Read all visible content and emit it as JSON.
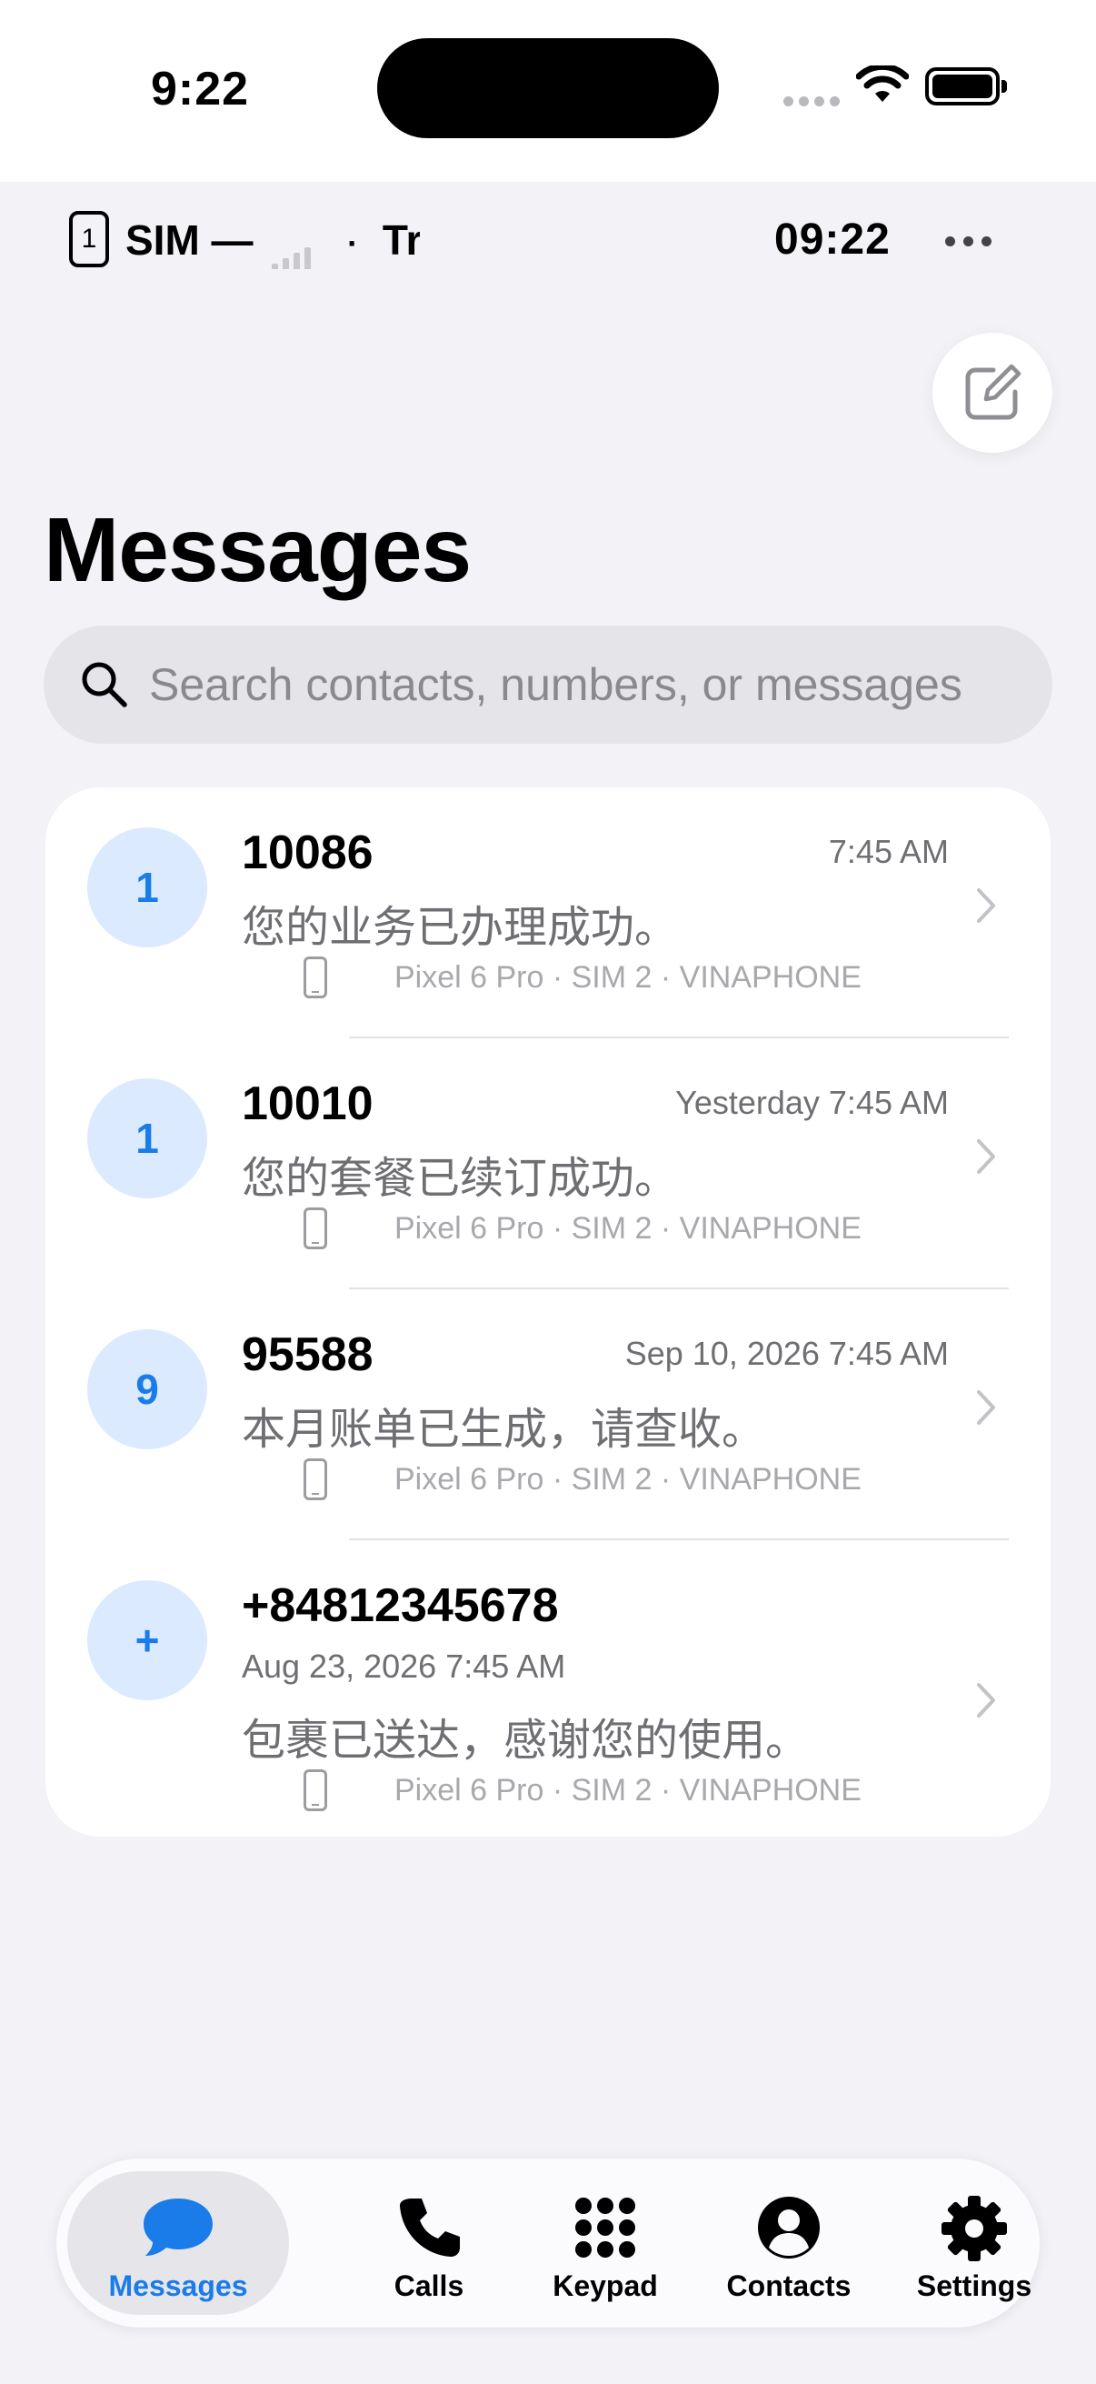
{
  "status_bar": {
    "time": "9:22",
    "battery_level": 1.0
  },
  "top_row": {
    "sim_number": "1",
    "ticker_text_a": "SIM —",
    "ticker_separator": "·",
    "ticker_text_b": "Travel",
    "clock": "09:22",
    "more_icon": "ellipsis-icon"
  },
  "compose_icon": "compose-icon",
  "page_title": "Messages",
  "search": {
    "placeholder": "Search contacts, numbers, or messages",
    "value": ""
  },
  "conversations": [
    {
      "avatar": "1",
      "name": "10086",
      "time": "7:45 AM",
      "preview": "您的业务已办理成功。",
      "meta": "Pixel 6 Pro · SIM 2 · VINAPHONE"
    },
    {
      "avatar": "1",
      "name": "10010",
      "time": "Yesterday 7:45 AM",
      "preview": "您的套餐已续订成功。",
      "meta": "Pixel 6 Pro · SIM 2 · VINAPHONE"
    },
    {
      "avatar": "9",
      "name": "95588",
      "time": "Sep 10, 2026 7:45 AM",
      "preview": "本月账单已生成，请查收。",
      "meta": "Pixel 6 Pro · SIM 2 · VINAPHONE"
    },
    {
      "avatar": "+",
      "name": "+84812345678",
      "time": "Aug 23, 2026 7:45 AM",
      "preview": "包裹已送达，感谢您的使用。",
      "meta": "Pixel 6 Pro · SIM 2 · VINAPHONE"
    }
  ],
  "tabs": [
    {
      "label": "Messages",
      "icon": "chat-bubble-icon",
      "active": true
    },
    {
      "label": "Calls",
      "icon": "phone-icon",
      "active": false
    },
    {
      "label": "Keypad",
      "icon": "keypad-icon",
      "active": false
    },
    {
      "label": "Contacts",
      "icon": "person-icon",
      "active": false
    },
    {
      "label": "Settings",
      "icon": "gear-icon",
      "active": false
    }
  ],
  "colors": {
    "accent": "#1a7ce8",
    "avatar_bg": "#dbeafe",
    "background": "#f2f2f7",
    "secondary_text": "#6e6e73"
  }
}
